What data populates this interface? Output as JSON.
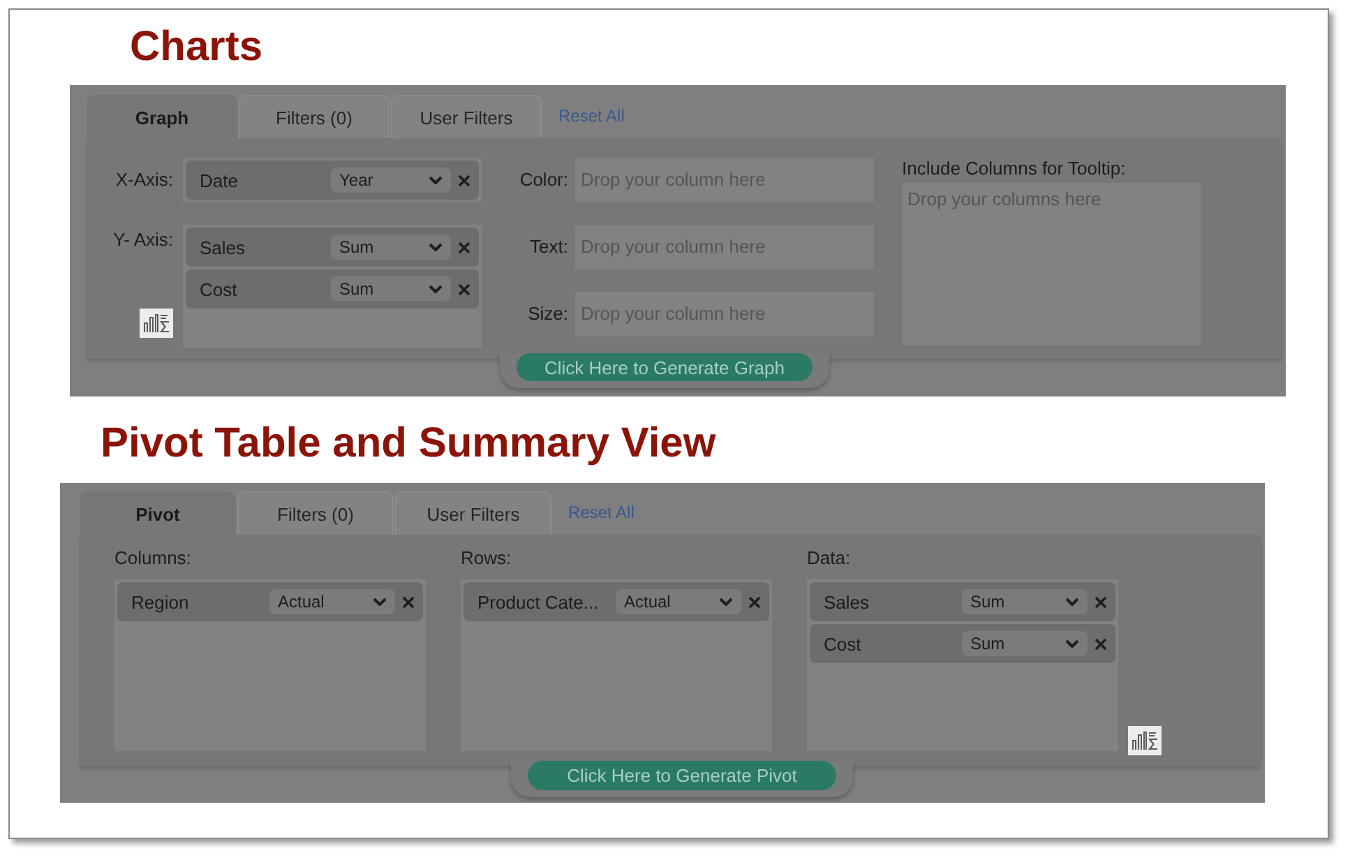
{
  "sections": [
    {
      "kind": "graph",
      "heading": "Charts",
      "tabs": [
        {
          "label": "Graph",
          "selected": true
        },
        {
          "label": "Filters (0)",
          "selected": false
        },
        {
          "label": "User Filters",
          "selected": false
        }
      ],
      "reset_link": "Reset All",
      "axes": [
        {
          "label": "X-Axis:",
          "items": [
            {
              "name": "Date",
              "aggregation": "Year"
            }
          ]
        },
        {
          "label": "Y- Axis:",
          "items": [
            {
              "name": "Sales",
              "aggregation": "Sum"
            },
            {
              "name": "Cost",
              "aggregation": "Sum"
            }
          ]
        }
      ],
      "encodings": [
        {
          "label": "Color:",
          "placeholder": "Drop your column here"
        },
        {
          "label": "Text:",
          "placeholder": "Drop your column here"
        },
        {
          "label": "Size:",
          "placeholder": "Drop your column here"
        }
      ],
      "tooltip": {
        "label": "Include Columns for Tooltip:",
        "placeholder": "Drop your columns here"
      },
      "generate_button": "Click Here to Generate Graph"
    },
    {
      "kind": "pivot",
      "heading": "Pivot Table and Summary View",
      "tabs": [
        {
          "label": "Pivot",
          "selected": true
        },
        {
          "label": "Filters (0)",
          "selected": false
        },
        {
          "label": "User Filters",
          "selected": false
        }
      ],
      "reset_link": "Reset All",
      "zones": [
        {
          "label": "Columns:",
          "items": [
            {
              "name": "Region",
              "aggregation": "Actual"
            }
          ]
        },
        {
          "label": "Rows:",
          "items": [
            {
              "name": "Product Cate...",
              "aggregation": "Actual"
            }
          ]
        },
        {
          "label": "Data:",
          "items": [
            {
              "name": "Sales",
              "aggregation": "Sum"
            },
            {
              "name": "Cost",
              "aggregation": "Sum"
            }
          ]
        }
      ],
      "generate_button": "Click Here to Generate Pivot"
    }
  ]
}
